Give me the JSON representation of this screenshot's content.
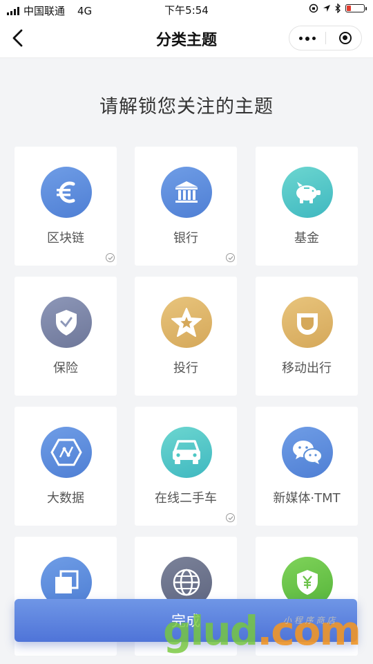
{
  "status_bar": {
    "carrier": "中国联通",
    "network": "4G",
    "time": "下午5:54"
  },
  "nav": {
    "title": "分类主题"
  },
  "heading": "请解锁您关注的主题",
  "topics": [
    {
      "label": "区块链",
      "icon": "euro-icon",
      "checked": true
    },
    {
      "label": "银行",
      "icon": "bank-icon",
      "checked": true
    },
    {
      "label": "基金",
      "icon": "piggy-bank-icon",
      "checked": false
    },
    {
      "label": "保险",
      "icon": "shield-icon",
      "checked": false
    },
    {
      "label": "投行",
      "icon": "star-icon",
      "checked": false
    },
    {
      "label": "移动出行",
      "icon": "didi-icon",
      "checked": false
    },
    {
      "label": "大数据",
      "icon": "hexagon-chart-icon",
      "checked": false
    },
    {
      "label": "在线二手车",
      "icon": "car-icon",
      "checked": true
    },
    {
      "label": "新媒体·TMT",
      "icon": "wechat-icon",
      "checked": false
    },
    {
      "label": "",
      "icon": "copy-icon",
      "checked": false
    },
    {
      "label": "",
      "icon": "globe-icon",
      "checked": false
    },
    {
      "label": "",
      "icon": "yuan-shield-icon",
      "checked": false
    }
  ],
  "done_label": "完成",
  "watermark": {
    "main": "glud",
    "dot": ".com",
    "sub": "小 程 序 商 店"
  },
  "colors": {
    "blue": "#5b8fd8",
    "slate": "#8e98b8",
    "gold": "#e0b76a",
    "teal": "#4dc7c4",
    "green": "#6cc24a",
    "gray": "#6d7489"
  }
}
